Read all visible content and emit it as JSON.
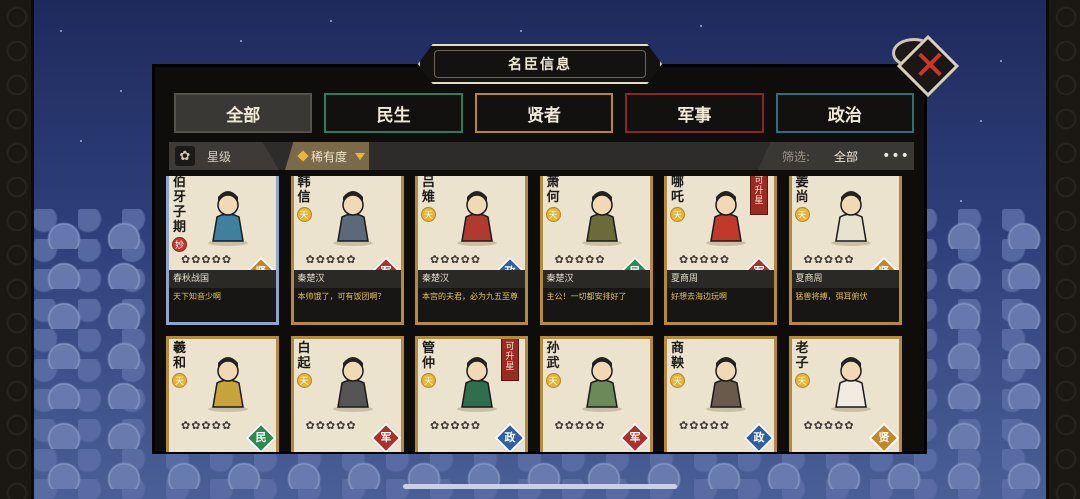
{
  "panel": {
    "title": "名臣信息"
  },
  "tabs": [
    {
      "label": "全部",
      "color": "#55524d"
    },
    {
      "label": "民生",
      "color": "#2e7a5a"
    },
    {
      "label": "贤者",
      "color": "#b8862c"
    },
    {
      "label": "军事",
      "color": "#8a2528"
    },
    {
      "label": "政治",
      "color": "#2f6f7a"
    }
  ],
  "filters": {
    "star_label": "星级",
    "sort_label": "稀有度",
    "screen_key": "筛选:",
    "screen_value": "全部",
    "more": "•••"
  },
  "colors": {
    "xian": "#c4862a",
    "jun": "#a9322a",
    "zheng": "#2f5fa0",
    "min": "#2e8a4e"
  },
  "cards": [
    {
      "name": "伯牙子期",
      "badge": "妙",
      "era": "春秋战国",
      "role": "贤",
      "quote": "天下知音少啊",
      "stars": "✿✿✿✿✿"
    },
    {
      "name": "韩信",
      "badge": "天",
      "era": "秦楚汉",
      "role": "军",
      "quote": "本帅饿了，可有饭团啊？",
      "stars": "✿✿✿✿✿"
    },
    {
      "name": "吕雉",
      "badge": "天",
      "era": "秦楚汉",
      "role": "政",
      "quote": "本宫的夫君，必为九五至尊",
      "stars": "✿✿✿✿✿"
    },
    {
      "name": "萧何",
      "badge": "天",
      "era": "秦楚汉",
      "role": "民",
      "quote": "主公！一切都安排好了",
      "stars": "✿✿✿✿✿"
    },
    {
      "name": "哪吒",
      "badge": "天",
      "era": "夏商周",
      "role": "军",
      "quote": "好想去海边玩啊",
      "stars": "✿✿✿✿✿",
      "upgrade": "可升星"
    },
    {
      "name": "姜尚",
      "badge": "天",
      "era": "夏商周",
      "role": "贤",
      "quote": "猛兽将搏，弭耳俯伏",
      "stars": "✿✿✿✿✿"
    },
    {
      "name": "羲和",
      "badge": "天",
      "era": "",
      "role": "民",
      "quote": "",
      "stars": "✿✿✿✿✿"
    },
    {
      "name": "白起",
      "badge": "天",
      "era": "",
      "role": "军",
      "quote": "",
      "stars": "✿✿✿✿✿"
    },
    {
      "name": "管仲",
      "badge": "天",
      "era": "",
      "role": "政",
      "quote": "",
      "stars": "✿✿✿✿✿",
      "upgrade": "可升星"
    },
    {
      "name": "孙武",
      "badge": "天",
      "era": "",
      "role": "军",
      "quote": "",
      "stars": "✿✿✿✿✿"
    },
    {
      "name": "商鞅",
      "badge": "天",
      "era": "",
      "role": "政",
      "quote": "",
      "stars": "✿✿✿✿✿"
    },
    {
      "name": "老子",
      "badge": "天",
      "era": "",
      "role": "贤",
      "quote": "",
      "stars": "✿✿✿✿✿"
    }
  ]
}
